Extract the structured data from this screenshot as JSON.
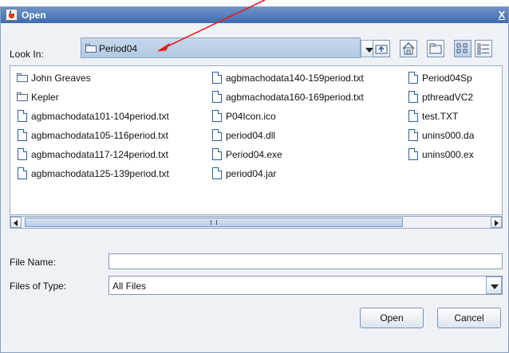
{
  "window": {
    "title": "Open",
    "close_glyph": "X"
  },
  "look_in": {
    "label": "Look In:",
    "value": "Period04",
    "icon": "folder-icon"
  },
  "toolbar": {
    "buttons": [
      {
        "name": "up-one-level-button",
        "icon": "up-folder-icon"
      },
      {
        "name": "home-button",
        "icon": "home-icon"
      },
      {
        "name": "new-folder-button",
        "icon": "new-folder-icon"
      },
      {
        "name": "list-view-button",
        "icon": "list-view-icon"
      },
      {
        "name": "details-view-button",
        "icon": "details-view-icon"
      }
    ]
  },
  "files": {
    "columns": [
      [
        {
          "label": "John Greaves",
          "type": "folder"
        },
        {
          "label": "Kepler",
          "type": "folder"
        },
        {
          "label": "agbmachodata101-104period.txt",
          "type": "file"
        },
        {
          "label": "agbmachodata105-116period.txt",
          "type": "file"
        },
        {
          "label": "agbmachodata117-124period.txt",
          "type": "file"
        },
        {
          "label": "agbmachodata125-139period.txt",
          "type": "file"
        }
      ],
      [
        {
          "label": "agbmachodata140-159period.txt",
          "type": "file"
        },
        {
          "label": "agbmachodata160-169period.txt",
          "type": "file"
        },
        {
          "label": "P04Icon.ico",
          "type": "file"
        },
        {
          "label": "period04.dll",
          "type": "file"
        },
        {
          "label": "Period04.exe",
          "type": "file"
        },
        {
          "label": "period04.jar",
          "type": "file"
        }
      ],
      [
        {
          "label": "Period04Sp",
          "type": "file"
        },
        {
          "label": "pthreadVC2",
          "type": "file"
        },
        {
          "label": "test.TXT",
          "type": "file"
        },
        {
          "label": "unins000.da",
          "type": "file"
        },
        {
          "label": "unins000.ex",
          "type": "file"
        }
      ]
    ]
  },
  "file_name": {
    "label": "File Name:",
    "value": "",
    "placeholder": ""
  },
  "file_type": {
    "label": "Files of Type:",
    "value": "All Files"
  },
  "buttons": {
    "open": "Open",
    "cancel": "Cancel"
  },
  "colors": {
    "titlebar": "#3d6aaf",
    "annotation_arrow": "#e02020"
  }
}
